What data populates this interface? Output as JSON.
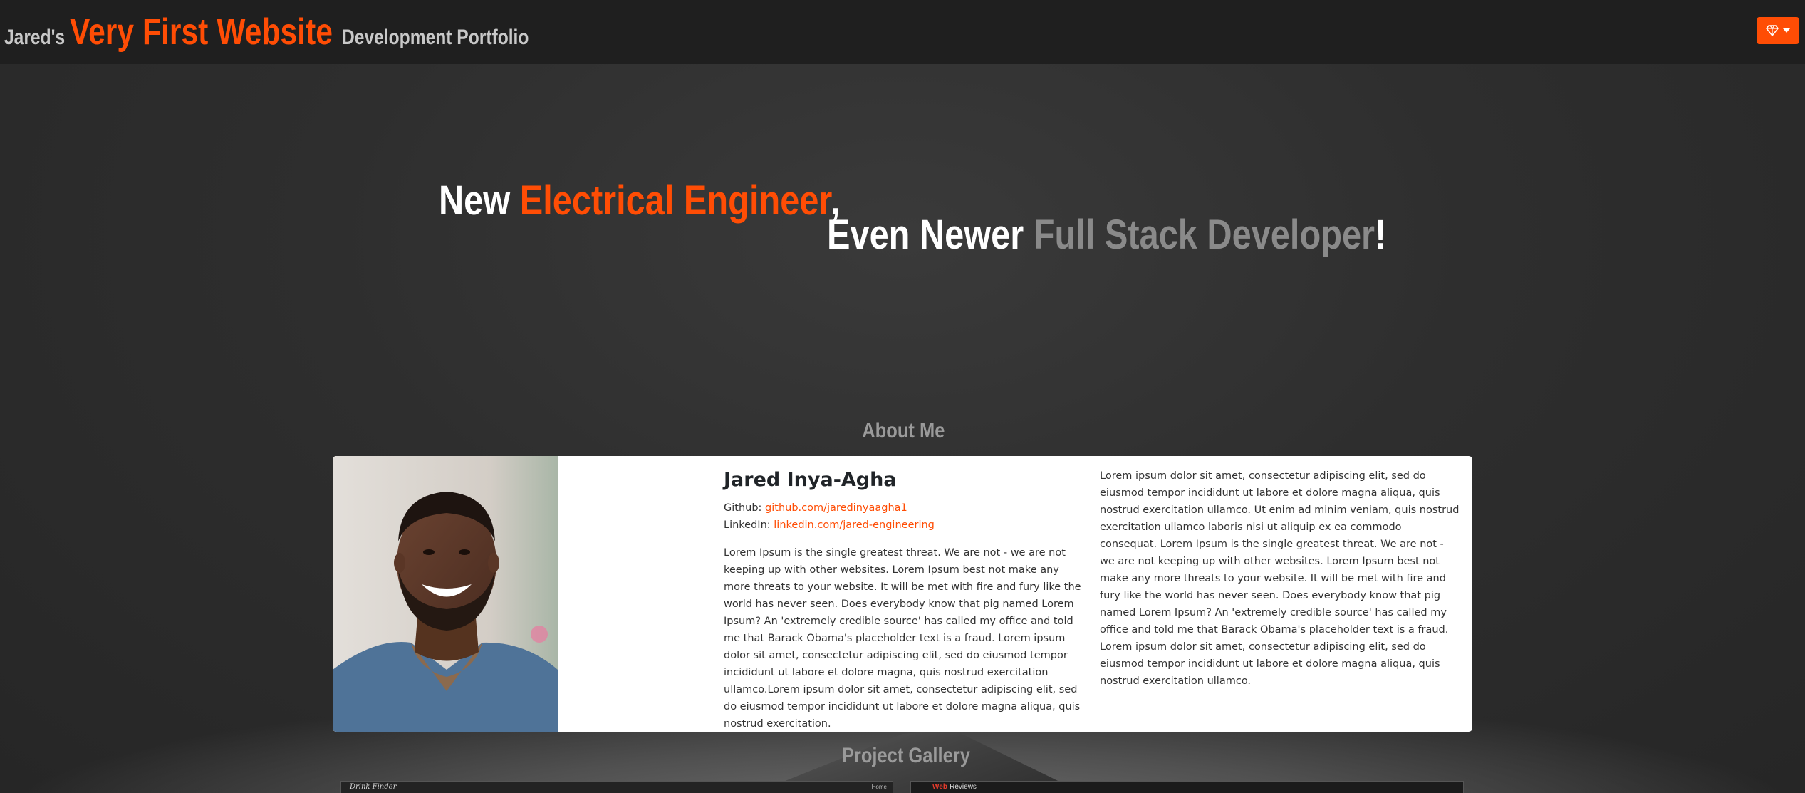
{
  "navbar": {
    "owner": "Jared's",
    "title": "Very First Website",
    "subtitle": "Development Portfolio",
    "menu_icon": "gem-icon"
  },
  "hero": {
    "line1_prefix": "New ",
    "line1_highlight": "Electrical Engineer",
    "line1_suffix": ",",
    "line2_prefix": "Even Newer ",
    "line2_highlight": "Full Stack Developer",
    "line2_suffix": "!"
  },
  "about": {
    "heading": "About Me",
    "name": "Jared Inya-Agha",
    "github_label": "Github:",
    "github_link": "github.com/jaredinyaagha1",
    "linkedin_label": "LinkedIn:",
    "linkedin_link": "linkedin.com/jared-engineering",
    "bio": "Lorem Ipsum is the single greatest threat. We are not - we are not keeping up with other websites. Lorem Ipsum best not make any more threats to your website. It will be met with fire and fury like the world has never seen. Does everybody know that pig named Lorem Ipsum? An 'extremely credible source' has called my office and told me that Barack Obama's placeholder text is a fraud. Lorem ipsum dolor sit amet, consectetur adipiscing elit, sed do eiusmod tempor incididunt ut labore et dolore magna, quis nostrud exercitation ullamco.Lorem ipsum dolor sit amet, consectetur adipiscing elit, sed do eiusmod tempor incididunt ut labore et dolore magna aliqua, quis nostrud exercitation.",
    "bio_right": "Lorem ipsum dolor sit amet, consectetur adipiscing elit, sed do eiusmod tempor incididunt ut labore et dolore magna aliqua, quis nostrud exercitation ullamco. Ut enim ad minim veniam, quis nostrud exercitation ullamco laboris nisi ut aliquip ex ea commodo consequat. Lorem Ipsum is the single greatest threat. We are not - we are not keeping up with other websites. Lorem Ipsum best not make any more threats to your website. It will be met with fire and fury like the world has never seen. Does everybody know that pig named Lorem Ipsum? An 'extremely credible source' has called my office and told me that Barack Obama's placeholder text is a fraud. Lorem ipsum dolor sit amet, consectetur adipiscing elit, sed do eiusmod tempor incididunt ut labore et dolore magna aliqua, quis nostrud exercitation ullamco."
  },
  "gallery": {
    "heading": "Project Gallery",
    "projects": [
      {
        "title": "Drink Finder",
        "nav": "Home"
      },
      {
        "title_a": "Web",
        "title_b": "Reviews"
      }
    ]
  },
  "colors": {
    "accent": "#ff4d05",
    "navbar_bg": "#1f1f1f",
    "muted_heading": "#9a9a9a"
  }
}
